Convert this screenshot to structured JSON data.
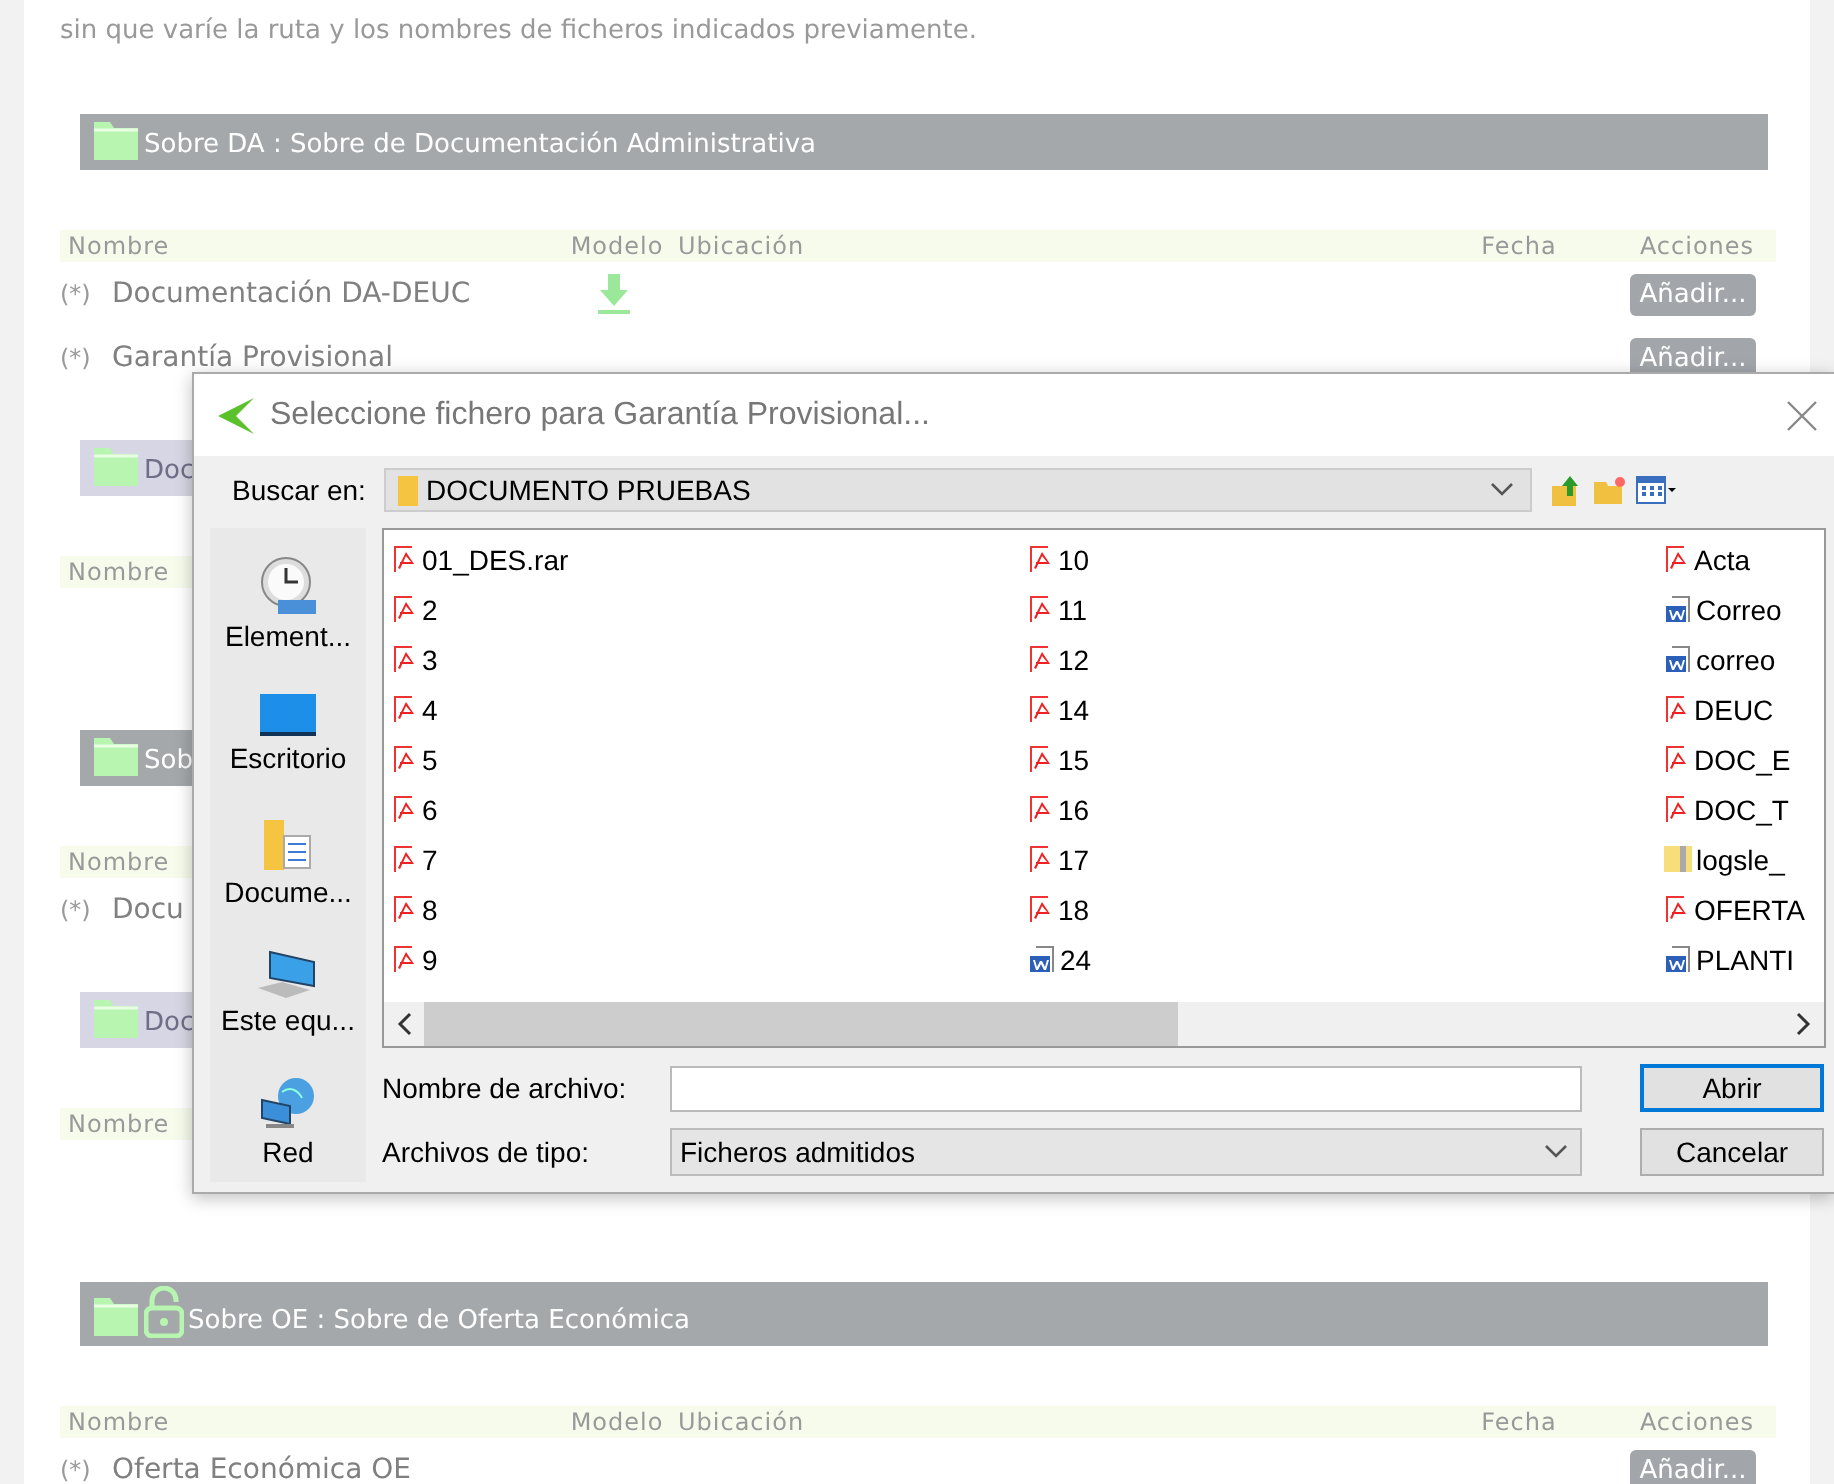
{
  "intro": "sin que varíe la ruta y los nombres de ficheros indicados previamente.",
  "sections": [
    {
      "title": "Sobre DA : Sobre de Documentación Administrativa",
      "kind": "dark",
      "locked": false,
      "columns": [
        "Nombre",
        "Modelo",
        "Ubicación",
        "Fecha",
        "Acciones"
      ],
      "rows": [
        {
          "mark": "(*)",
          "name": "Documentación DA-DEUC",
          "model": true,
          "button": "Añadir..."
        },
        {
          "mark": "(*)",
          "name": "Garantía Provisional",
          "model": false,
          "button": "Añadir..."
        }
      ]
    },
    {
      "title": "Doc",
      "kind": "light",
      "locked": false,
      "columns": [
        "Nombre"
      ]
    },
    {
      "title": "Sob",
      "kind": "dark",
      "locked": false,
      "columns": [
        "Nombre"
      ],
      "rows": [
        {
          "mark": "(*)",
          "name": "Docu",
          "model": false
        }
      ]
    },
    {
      "title": "Doc",
      "kind": "light",
      "locked": false,
      "columns": [
        "Nombre"
      ]
    },
    {
      "title": "Sobre OE : Sobre de Oferta Económica",
      "kind": "dark",
      "locked": true,
      "columns": [
        "Nombre",
        "Modelo",
        "Ubicación",
        "Fecha",
        "Acciones"
      ],
      "rows": [
        {
          "mark": "(*)",
          "name": "Oferta Económica OE",
          "model": false,
          "button": "Añadir..."
        }
      ]
    }
  ],
  "dialog": {
    "title": "Seleccione fichero para Garantía Provisional...",
    "look_in": {
      "label": "Buscar en:",
      "value": "DOCUMENTO PRUEBAS"
    },
    "places": [
      {
        "kind": "recent",
        "label": "Element..."
      },
      {
        "kind": "desktop",
        "label": "Escritorio"
      },
      {
        "kind": "documents",
        "label": "Docume..."
      },
      {
        "kind": "computer",
        "label": "Este equ..."
      },
      {
        "kind": "network",
        "label": "Red"
      }
    ],
    "files": [
      {
        "kind": "pdf",
        "name": "01_DES.rar"
      },
      {
        "kind": "pdf",
        "name": "2"
      },
      {
        "kind": "pdf",
        "name": "3"
      },
      {
        "kind": "pdf",
        "name": "4"
      },
      {
        "kind": "pdf",
        "name": "5"
      },
      {
        "kind": "pdf",
        "name": "6"
      },
      {
        "kind": "pdf",
        "name": "7"
      },
      {
        "kind": "pdf",
        "name": "8"
      },
      {
        "kind": "pdf",
        "name": "9"
      },
      {
        "kind": "pdf",
        "name": "10"
      },
      {
        "kind": "pdf",
        "name": "11"
      },
      {
        "kind": "pdf",
        "name": "12"
      },
      {
        "kind": "pdf",
        "name": "14"
      },
      {
        "kind": "pdf",
        "name": "15"
      },
      {
        "kind": "pdf",
        "name": "16"
      },
      {
        "kind": "pdf",
        "name": "17"
      },
      {
        "kind": "pdf",
        "name": "18"
      },
      {
        "kind": "word",
        "name": "24"
      },
      {
        "kind": "pdf",
        "name": "Acta"
      },
      {
        "kind": "word",
        "name": "Correo"
      },
      {
        "kind": "word",
        "name": "correo"
      },
      {
        "kind": "pdf",
        "name": "DEUC"
      },
      {
        "kind": "pdf",
        "name": "DOC_E"
      },
      {
        "kind": "pdf",
        "name": "DOC_T"
      },
      {
        "kind": "archive",
        "name": "logsle_"
      },
      {
        "kind": "pdf",
        "name": "OFERTA"
      },
      {
        "kind": "word",
        "name": "PLANTI"
      }
    ],
    "file_name": {
      "label": "Nombre de archivo:"
    },
    "file_type": {
      "label": "Archivos de tipo:",
      "value": "Ficheros admitidos"
    },
    "buttons": [
      {
        "label": "Abrir",
        "default": true
      },
      {
        "label": "Cancelar",
        "default": false
      }
    ]
  }
}
